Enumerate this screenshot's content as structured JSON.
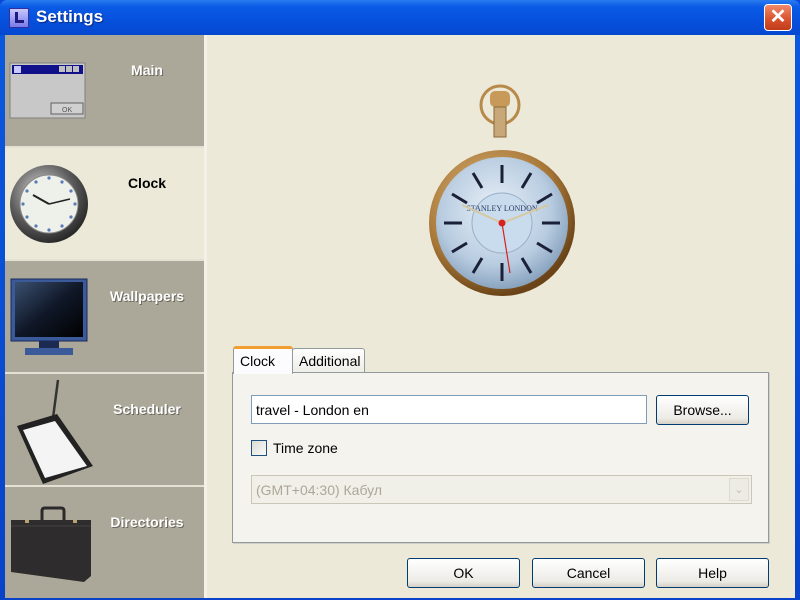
{
  "window": {
    "title": "Settings",
    "close_label": "✕"
  },
  "sidebar": {
    "active": "Clock",
    "items": [
      {
        "label": "Main",
        "icon": "window-icon"
      },
      {
        "label": "Clock",
        "icon": "wall-clock-icon"
      },
      {
        "label": "Wallpapers",
        "icon": "monitor-icon"
      },
      {
        "label": "Scheduler",
        "icon": "notepad-icon"
      },
      {
        "label": "Directories",
        "icon": "briefcase-icon"
      }
    ]
  },
  "preview": {
    "watch_brand": "STANLEY LONDON"
  },
  "tabs": [
    {
      "label": "Clock",
      "active": true
    },
    {
      "label": "Additional",
      "active": false
    }
  ],
  "clock_tab": {
    "theme_value": "travel - London en",
    "browse_label": "Browse...",
    "timezone_checkbox_label": "Time zone",
    "timezone_checked": false,
    "timezone_select_value": "(GMT+04:30) Кабул",
    "timezone_select_enabled": false
  },
  "footer": {
    "ok_label": "OK",
    "cancel_label": "Cancel",
    "help_label": "Help"
  },
  "colors": {
    "titlebar": "#0a5ae6",
    "sidebar_bg": "#aca899",
    "content_bg": "#ece9d8",
    "close_button": "#d8502c",
    "active_tab_accent": "#f0a030"
  }
}
